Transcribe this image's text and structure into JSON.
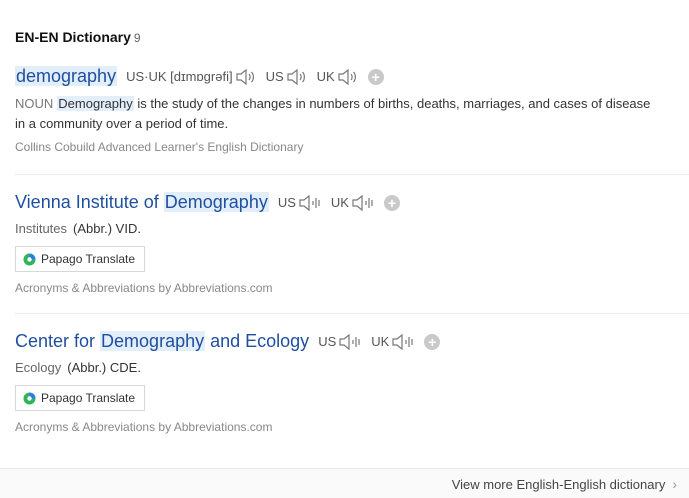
{
  "section": {
    "title": "EN-EN Dictionary",
    "count": "9"
  },
  "entries": [
    {
      "term_hl": "demography",
      "pron_region": "US·UK",
      "pron_ipa": "[dɪmɒgrəfi]",
      "us": "US",
      "uk": "UK",
      "pos": "NOUN",
      "def_hl": "Demography",
      "def_rest": " is the study of the changes in numbers of births, deaths, marriages, and cases of disease in a community over a period of time.",
      "source": "Collins Cobuild Advanced Learner's English Dictionary"
    },
    {
      "term_pre": "Vienna Institute of ",
      "term_hl": "Demography",
      "us": "US",
      "uk": "UK",
      "category": "Institutes",
      "abbr": "(Abbr.) VID.",
      "papago": "Papago Translate",
      "source": "Acronyms & Abbreviations by Abbreviations.com"
    },
    {
      "term_pre": "Center for ",
      "term_hl": "Demography",
      "term_post": " and Ecology",
      "us": "US",
      "uk": "UK",
      "category": "Ecology",
      "abbr": "(Abbr.) CDE.",
      "papago": "Papago Translate",
      "source": "Acronyms & Abbreviations by Abbreviations.com"
    }
  ],
  "footer": {
    "more_label": "View more English-English dictionary"
  },
  "icons": {
    "speaker": "speaker-icon",
    "add": "plus-circle-icon",
    "papago": "papago-logo-icon",
    "chevron": "chevron-right-icon"
  },
  "colors": {
    "link": "#1f4fa0",
    "highlight": "#e3eefb",
    "papago_green": "#2fb45a",
    "papago_blue": "#2b7de9"
  }
}
